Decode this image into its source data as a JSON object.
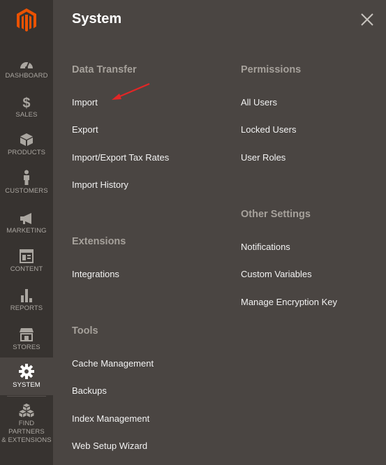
{
  "sidebar": {
    "logo": "magento-logo",
    "items": [
      {
        "label": "DASHBOARD",
        "icon": "dashboard-icon"
      },
      {
        "label": "SALES",
        "icon": "dollar-icon"
      },
      {
        "label": "PRODUCTS",
        "icon": "cube-icon"
      },
      {
        "label": "CUSTOMERS",
        "icon": "person-icon"
      },
      {
        "label": "MARKETING",
        "icon": "megaphone-icon"
      },
      {
        "label": "CONTENT",
        "icon": "layout-icon"
      },
      {
        "label": "REPORTS",
        "icon": "bar-chart-icon"
      },
      {
        "label": "STORES",
        "icon": "storefront-icon"
      },
      {
        "label": "SYSTEM",
        "icon": "gear-icon",
        "active": true
      },
      {
        "label_line1": "FIND PARTNERS",
        "label_line2": "& EXTENSIONS",
        "icon": "boxes-icon"
      }
    ]
  },
  "panel": {
    "title": "System",
    "close_icon": "close-icon",
    "sections": {
      "data_transfer": {
        "title": "Data Transfer",
        "links": [
          "Import",
          "Export",
          "Import/Export Tax Rates",
          "Import History"
        ]
      },
      "extensions": {
        "title": "Extensions",
        "links": [
          "Integrations"
        ]
      },
      "tools": {
        "title": "Tools",
        "links": [
          "Cache Management",
          "Backups",
          "Index Management",
          "Web Setup Wizard"
        ]
      },
      "permissions": {
        "title": "Permissions",
        "links": [
          "All Users",
          "Locked Users",
          "User Roles"
        ]
      },
      "other_settings": {
        "title": "Other Settings",
        "links": [
          "Notifications",
          "Custom Variables",
          "Manage Encryption Key"
        ]
      }
    }
  },
  "colors": {
    "sidebar_bg": "#373330",
    "panel_bg": "#4a4542",
    "logo_orange": "#eb5202",
    "annotation_arrow": "#e22626"
  }
}
